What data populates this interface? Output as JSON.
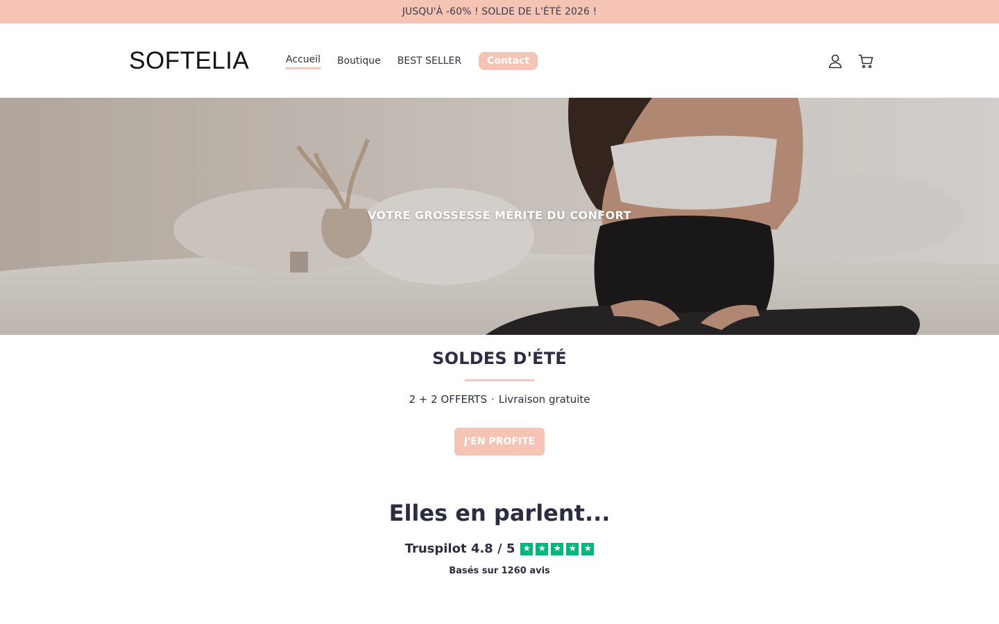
{
  "announcement": {
    "text": "JUSQU'À -60% ! SOLDE DE L'ÉTÉ 2026 !"
  },
  "header": {
    "logo": "SOFTELIA",
    "nav": [
      {
        "label": "Accueil"
      },
      {
        "label": "Boutique"
      },
      {
        "label": "BEST SELLER"
      },
      {
        "label": "Contact"
      }
    ],
    "icons": [
      "account-icon",
      "cart-icon"
    ]
  },
  "hero": {
    "title": "VOTRE GROSSESSE MÉRITE DU CONFORT"
  },
  "sale": {
    "title": "SOLDES D'ÉTÉ",
    "offer": "2 + 2 OFFERTS",
    "separator": "·",
    "shipping": "Livraison gratuite",
    "cta": "J'EN PROFITE"
  },
  "reviews": {
    "title": "Elles en parlent...",
    "source": "Truspilot 4.8 / 5",
    "rating": 4.8,
    "stars": 5,
    "count_text": "Basés sur 1260 avis"
  },
  "colors": {
    "accent": "#f5c4b4",
    "text": "#2b2d42",
    "trustpilot": "#00b67a"
  }
}
